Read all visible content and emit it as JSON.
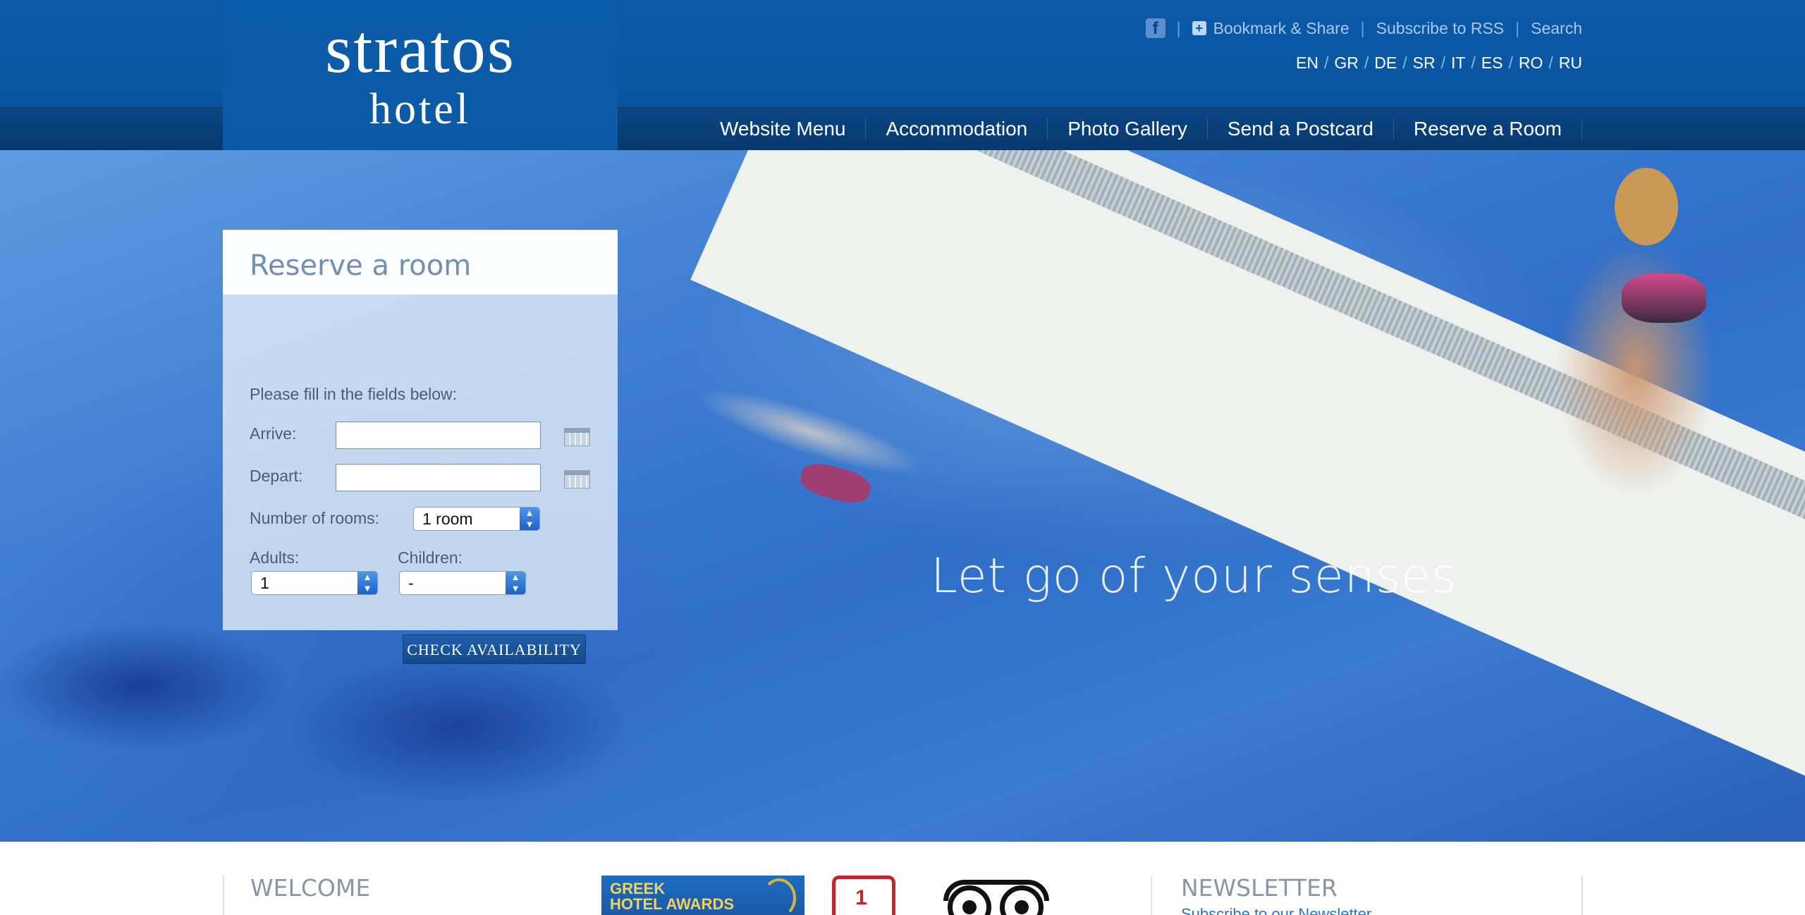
{
  "brand": {
    "line1": "stratos",
    "line2": "hotel"
  },
  "top_links": {
    "facebook_icon": "facebook-icon",
    "bookmark_share": "Bookmark & Share",
    "subscribe_rss": "Subscribe to RSS",
    "search": "Search"
  },
  "languages": [
    "EN",
    "GR",
    "DE",
    "SR",
    "IT",
    "ES",
    "RO",
    "RU"
  ],
  "nav": [
    "Website Menu",
    "Accommodation",
    "Photo Gallery",
    "Send a Postcard",
    "Reserve a Room"
  ],
  "hero": {
    "tagline": "Let go of your senses"
  },
  "reserve": {
    "title": "Reserve a room",
    "instructions": "Please fill in the fields below:",
    "arrive_label": "Arrive:",
    "arrive_value": "",
    "depart_label": "Depart:",
    "depart_value": "",
    "rooms_label": "Number of rooms:",
    "rooms_value": "1 room",
    "adults_label": "Adults:",
    "adults_value": "1",
    "children_label": "Children:",
    "children_value": "-",
    "check_button": "CHECK AVAILABILITY"
  },
  "footer": {
    "welcome": "WELCOME",
    "newsletter": "NEWSLETTER",
    "newsletter_sub": "Subscribe to our Newsletter",
    "award_line1": "GREEK",
    "award_line2": "HOTEL AWARDS"
  },
  "colors": {
    "header_blue": "#0a55a0",
    "nav_dark": "#08386d",
    "accent_text": "#6f8fb3"
  }
}
